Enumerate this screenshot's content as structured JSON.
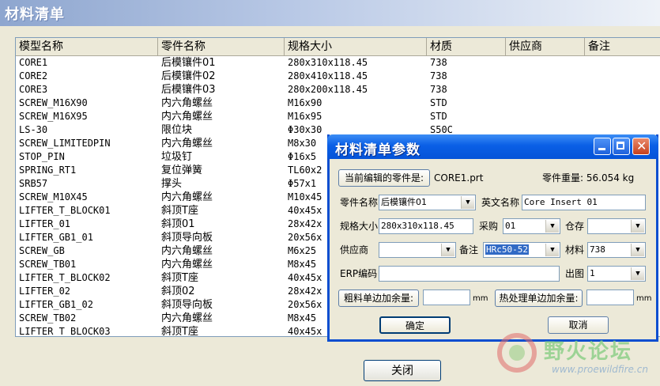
{
  "window": {
    "title": "材料清单"
  },
  "table": {
    "columns": [
      "模型名称",
      "零件名称",
      "规格大小",
      "材质",
      "供应商",
      "备注"
    ],
    "rows": [
      [
        "CORE1",
        "后模镶件01",
        "280x310x118.45",
        "738"
      ],
      [
        "CORE2",
        "后模镶件02",
        "280x410x118.45",
        "738"
      ],
      [
        "CORE3",
        "后模镶件03",
        "280x200x118.45",
        "738"
      ],
      [
        "SCREW_M16X90",
        "内六角螺丝",
        "M16x90",
        "STD"
      ],
      [
        "SCREW_M16X95",
        "内六角螺丝",
        "M16x95",
        "STD"
      ],
      [
        "LS-30",
        "限位块",
        "Φ30x30",
        "S50C"
      ],
      [
        "SCREW_LIMITEDPIN",
        "内六角螺丝",
        "M8x30",
        ""
      ],
      [
        "STOP_PIN",
        "垃圾钉",
        "Φ16x5",
        ""
      ],
      [
        "SPRING_RT1",
        "复位弹簧",
        "TL60x2",
        ""
      ],
      [
        "SRB57",
        "撑头",
        "Φ57x1",
        ""
      ],
      [
        "SCREW_M10X45",
        "内六角螺丝",
        "M10x45",
        ""
      ],
      [
        "LIFTER_T_BLOCK01",
        "斜顶T座",
        "40x45x",
        ""
      ],
      [
        "LIFTER_01",
        "斜顶01",
        "28x42x",
        ""
      ],
      [
        "LIFTER_GB1_01",
        "斜顶导向板",
        "20x56x",
        ""
      ],
      [
        "SCREW_GB",
        "内六角螺丝",
        "M6x25",
        ""
      ],
      [
        "SCREW_TB01",
        "内六角螺丝",
        "M8x45",
        ""
      ],
      [
        "LIFTER_T_BLOCK02",
        "斜顶T座",
        "40x45x",
        ""
      ],
      [
        "LIFTER_02",
        "斜顶02",
        "28x42x",
        ""
      ],
      [
        "LIFTER_GB1_02",
        "斜顶导向板",
        "20x56x",
        ""
      ],
      [
        "SCREW_TB02",
        "内六角螺丝",
        "M8x45",
        ""
      ],
      [
        "LIFTER_T_BLOCK03",
        "斜顶T座",
        "40x45x",
        ""
      ]
    ]
  },
  "close_button": "关闭",
  "dialog": {
    "title": "材料清单参数",
    "current_part_button": "当前编辑的零件是:",
    "current_part_value": "CORE1.prt",
    "part_weight": "零件重量: 56.054 kg",
    "part_name_label": "零件名称",
    "part_name_value": "后模镶件01",
    "english_name_label": "英文名称",
    "english_name_value": "Core Insert 01",
    "size_label": "规格大小",
    "size_value": "280x310x118.45",
    "purchase_label": "采购",
    "purchase_value": "01",
    "warehouse_label": "仓存",
    "warehouse_value": "",
    "supplier_label": "供应商",
    "supplier_value": "",
    "remark_label": "备注",
    "remark_value": "HRc50-52",
    "material_label": "材料",
    "material_value": "738",
    "erp_label": "ERP编码",
    "erp_value": "",
    "drawing_label": "出图",
    "drawing_value": "1",
    "rough_allowance_button": "粗料单边加余量:",
    "rough_allowance_value": "",
    "rough_unit": "mm",
    "heat_allowance_button": "热处理单边加余量:",
    "heat_allowance_value": "",
    "heat_unit": "mm",
    "ok_button": "确定",
    "cancel_button": "取消"
  },
  "watermark": {
    "text": "野火论坛",
    "url": "www.proewildfire.cn"
  }
}
